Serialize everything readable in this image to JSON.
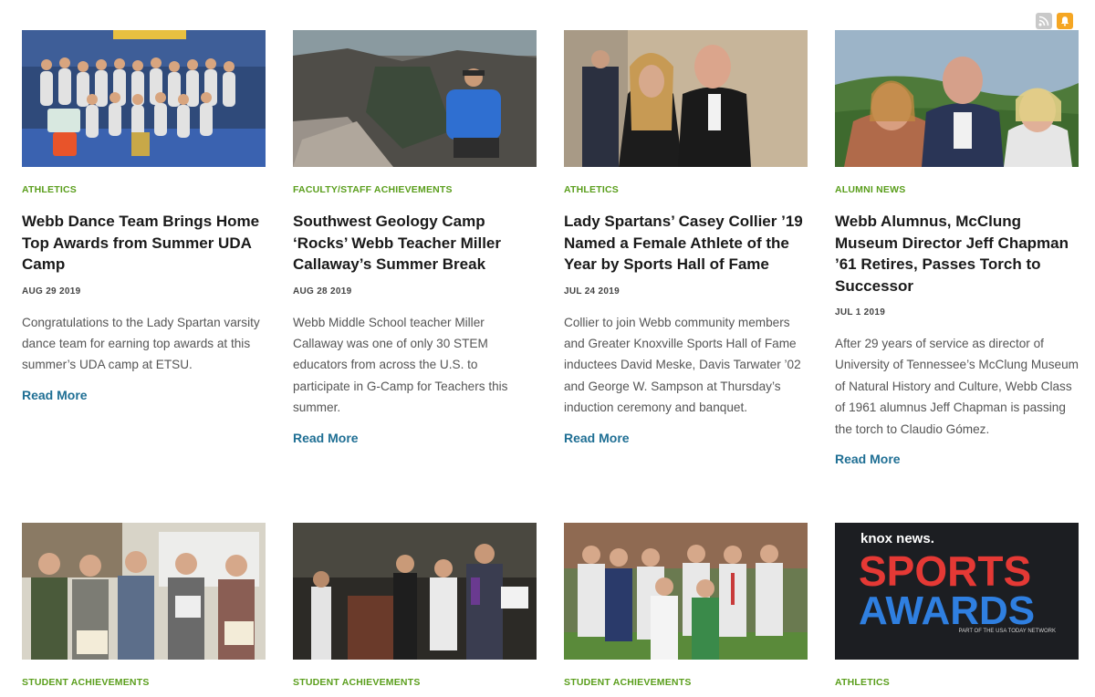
{
  "header": {
    "rss_icon": "rss-icon",
    "notify_icon": "bell-icon",
    "colors": {
      "category": "#5a9e1c",
      "link": "#1f6f94",
      "notify": "#f5a623"
    }
  },
  "articles": [
    {
      "category": "ATHLETICS",
      "title": "Webb Dance Team Brings Home Top Awards from Summer UDA Camp",
      "date": "AUG 29 2019",
      "excerpt": "Congratulations to the Lady Spartan varsity dance team for earning top awards at this summer’s UDA camp at ETSU.",
      "read_more": "Read More"
    },
    {
      "category": "FACULTY/STAFF ACHIEVEMENTS",
      "title": "Southwest Geology Camp ‘Rocks’ Webb Teacher Miller Callaway’s Summer Break",
      "date": "AUG 28 2019",
      "excerpt": "Webb Middle School teacher Miller Callaway was one of only 30 STEM educators from across the U.S. to participate in G-Camp for Teachers this summer.",
      "read_more": "Read More"
    },
    {
      "category": "ATHLETICS",
      "title": "Lady Spartans’ Casey Collier ’19 Named a Female Athlete of the Year by Sports Hall of Fame",
      "date": "JUL 24 2019",
      "excerpt": "Collier to join Webb community members and Greater Knoxville Sports Hall of Fame inductees David Meske, Davis Tarwater ’02 and George W. Sampson at Thursday’s induction ceremony and banquet.",
      "read_more": "Read More"
    },
    {
      "category": "ALUMNI NEWS",
      "title": "Webb Alumnus, McClung Museum Director Jeff Chapman ’61 Retires, Passes Torch to Successor",
      "date": "JUL 1 2019",
      "excerpt": "After 29 years of service as director of University of Tennessee’s McClung Museum of Natural History and Culture, Webb Class of 1961 alumnus Jeff Chapman is passing the torch to Claudio Gómez.",
      "read_more": "Read More"
    },
    {
      "category": "STUDENT ACHIEVEMENTS"
    },
    {
      "category": "STUDENT ACHIEVEMENTS"
    },
    {
      "category": "STUDENT ACHIEVEMENTS"
    },
    {
      "category": "ATHLETICS",
      "logo": {
        "line1": "knox news.",
        "line2": "SPORTS",
        "line3": "AWARDS",
        "tagline": "PART OF THE USA TODAY NETWORK"
      }
    }
  ]
}
